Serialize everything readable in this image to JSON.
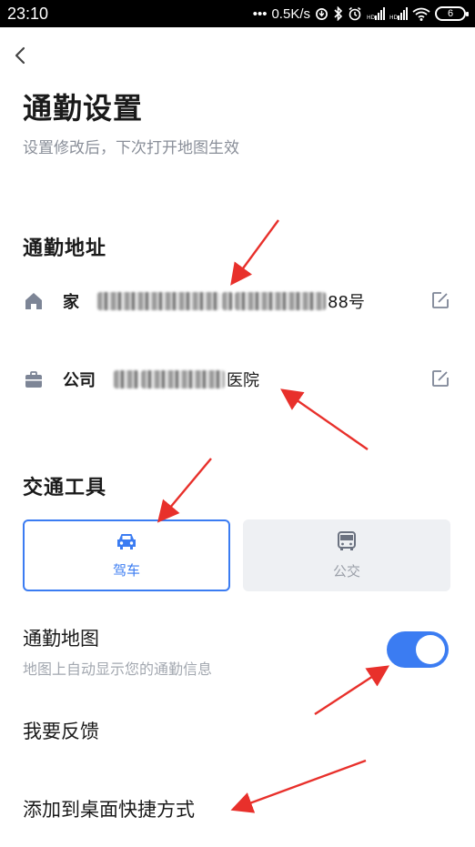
{
  "status_bar": {
    "time": "23:10",
    "dots": "•••",
    "speed": "0.5K/s",
    "battery": "6",
    "icons": [
      "data-saver-icon",
      "bluetooth-icon",
      "alarm-icon",
      "signal-icon",
      "signal-icon",
      "wifi-icon",
      "battery-icon"
    ]
  },
  "header": {
    "back_icon": "chevron-left-icon",
    "title": "通勤设置",
    "subtitle": "设置修改后，下次打开地图生效"
  },
  "address_section": {
    "title": "通勤地址",
    "home": {
      "icon": "home-icon",
      "label": "家",
      "value_visible_suffix": "88号",
      "edit_icon": "edit-icon"
    },
    "work": {
      "icon": "briefcase-icon",
      "label": "公司",
      "value_visible_suffix": "医院",
      "edit_icon": "edit-icon"
    }
  },
  "transport_section": {
    "title": "交通工具",
    "options": [
      {
        "label": "驾车",
        "icon": "car-icon",
        "selected": true
      },
      {
        "label": "公交",
        "icon": "bus-icon",
        "selected": false
      }
    ]
  },
  "commute_map": {
    "title": "通勤地图",
    "description": "地图上自动显示您的通勤信息",
    "enabled": true
  },
  "menu": {
    "feedback": "我要反馈",
    "add_shortcut": "添加到桌面快捷方式"
  },
  "colors": {
    "accent": "#3b7cf2",
    "icon_gray": "#7d8596",
    "annotation_red": "#e8302b"
  }
}
